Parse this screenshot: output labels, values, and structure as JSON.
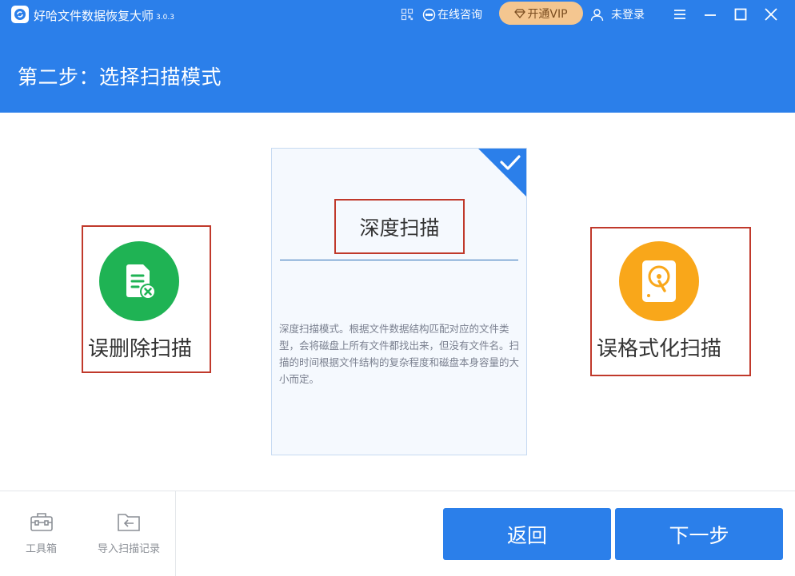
{
  "app": {
    "title": "好哈文件数据恢复大师",
    "version": "3.0.3",
    "online_consult": "在线咨询",
    "vip_label": "开通VIP",
    "login_label": "未登录"
  },
  "header": {
    "step_title": "第二步：选择扫描模式"
  },
  "modes": {
    "deleted_scan": {
      "label": "误删除扫描",
      "icon": "file-delete-icon",
      "color": "#1fb354"
    },
    "deep_scan": {
      "label": "深度扫描",
      "selected": true,
      "description": "深度扫描模式。根据文件数据结构匹配对应的文件类型，会将磁盘上所有文件都找出来，但没有文件名。扫描的时间根据文件结构的复杂程度和磁盘本身容量的大小而定。"
    },
    "format_scan": {
      "label": "误格式化扫描",
      "icon": "hard-disk-icon",
      "color": "#f9a71a"
    }
  },
  "footer": {
    "toolbox_label": "工具箱",
    "import_label": "导入扫描记录",
    "back_label": "返回",
    "next_label": "下一步"
  },
  "colors": {
    "primary": "#2b7fea",
    "highlight_border": "#c0392b",
    "vip_bg": "#f4c690"
  }
}
